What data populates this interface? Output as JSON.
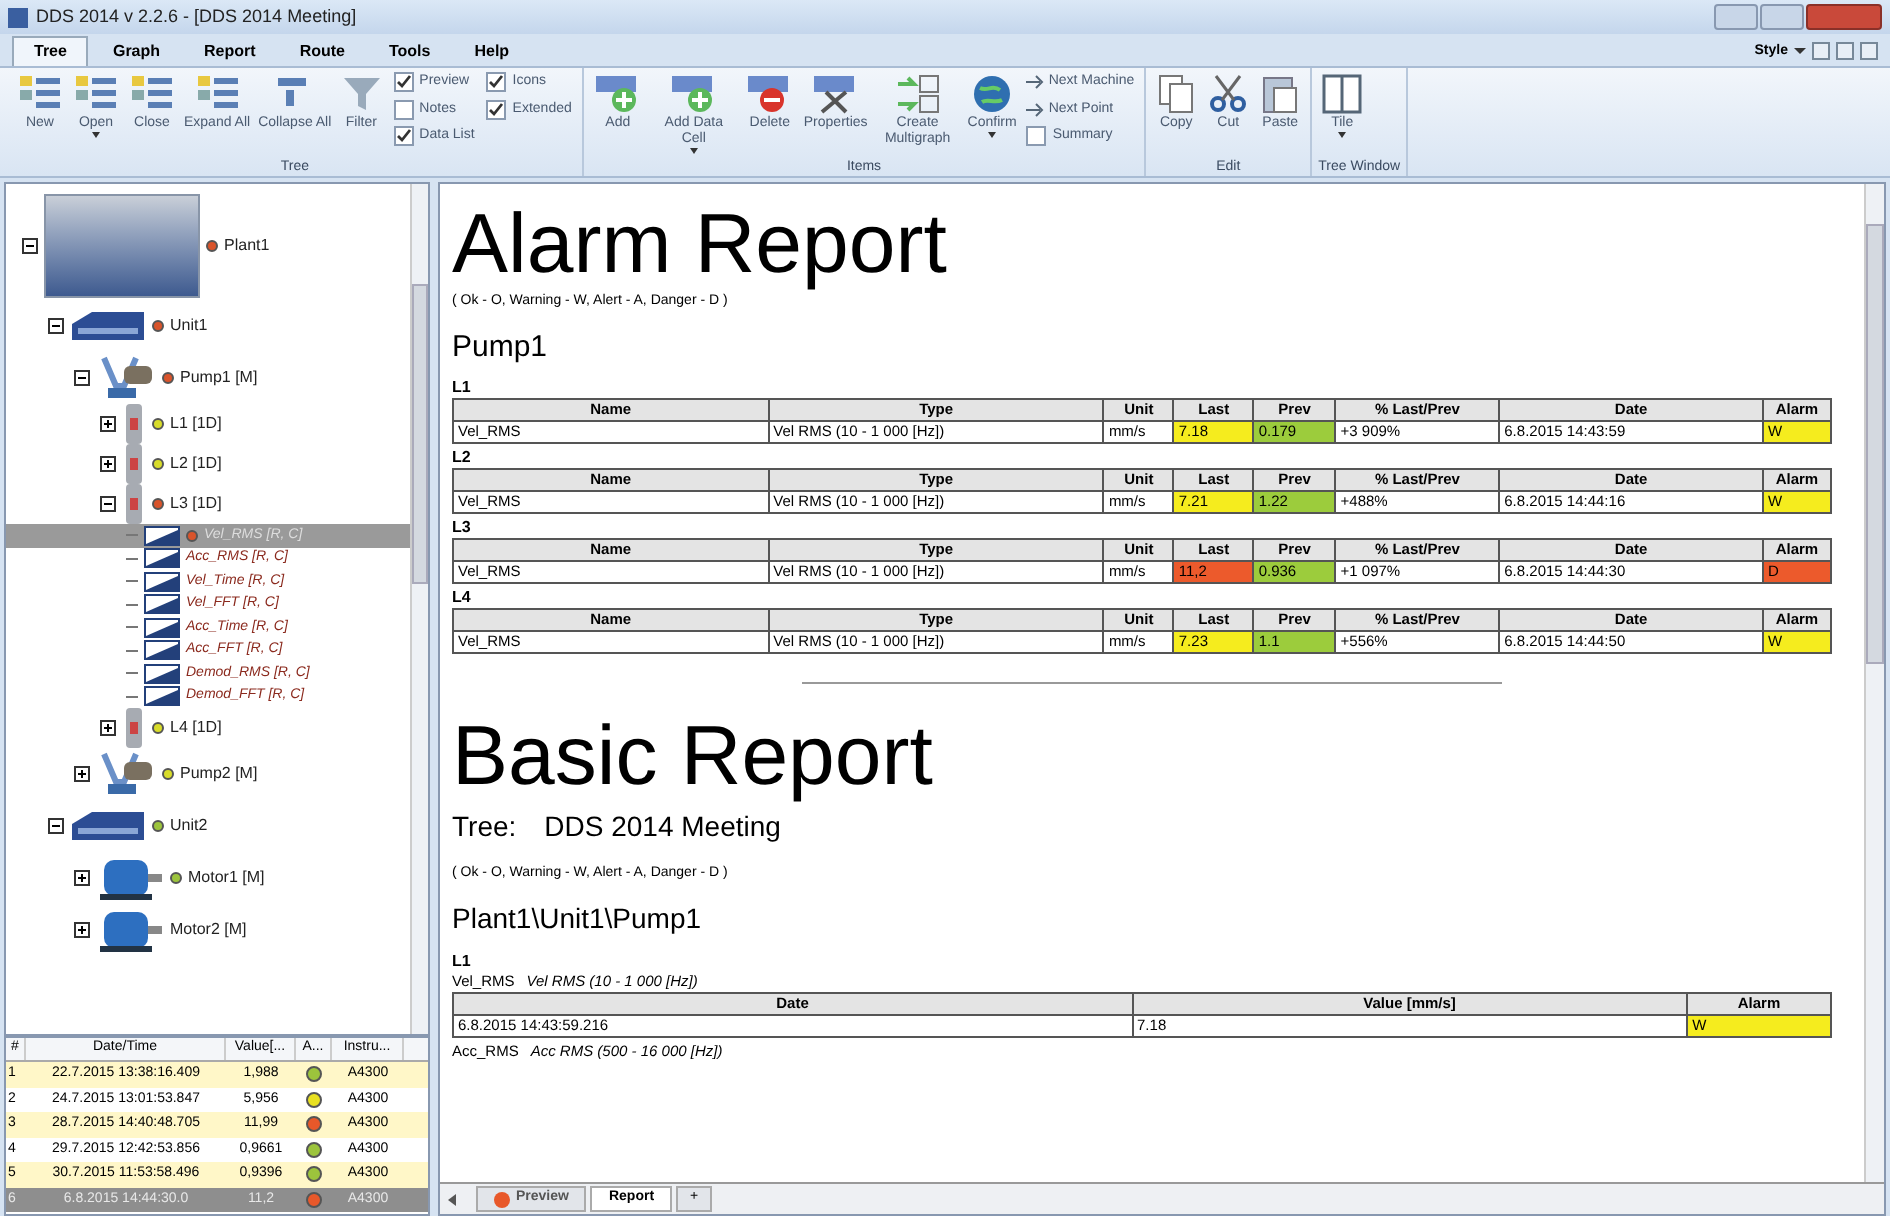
{
  "window": {
    "title": "DDS 2014 v 2.2.6 - [DDS 2014 Meeting]"
  },
  "menu_tabs": [
    {
      "label": "Tree",
      "selected": true
    },
    {
      "label": "Graph",
      "selected": false
    },
    {
      "label": "Report",
      "selected": false
    },
    {
      "label": "Route",
      "selected": false
    },
    {
      "label": "Tools",
      "selected": false
    },
    {
      "label": "Help",
      "selected": false
    }
  ],
  "style_menu": "Style",
  "ribbon": [
    {
      "name": "Tree",
      "items": [
        {
          "kind": "button",
          "label": "New"
        },
        {
          "kind": "button",
          "label": "Open",
          "dropdown": true
        },
        {
          "kind": "button",
          "label": "Close"
        },
        {
          "kind": "button",
          "label": "Expand All"
        },
        {
          "kind": "button",
          "label": "Collapse All"
        },
        {
          "kind": "button",
          "label": "Filter"
        },
        {
          "kind": "checks",
          "checks": [
            {
              "label": "Preview",
              "checked": true
            },
            {
              "label": "Notes",
              "checked": false
            },
            {
              "label": "Data List",
              "checked": true
            }
          ]
        },
        {
          "kind": "checks",
          "checks": [
            {
              "label": "Icons",
              "checked": true
            },
            {
              "label": "Extended",
              "checked": true
            }
          ]
        }
      ]
    },
    {
      "name": "Items",
      "items": [
        {
          "kind": "button",
          "label": "Add"
        },
        {
          "kind": "button",
          "label": "Add Data Cell",
          "dropdown": true
        },
        {
          "kind": "button",
          "label": "Delete"
        },
        {
          "kind": "button",
          "label": "Properties"
        },
        {
          "kind": "button",
          "label": "Create Multigraph"
        },
        {
          "kind": "button",
          "label": "Confirm",
          "dropdown": true
        },
        {
          "kind": "small",
          "items": [
            {
              "label": "Next Machine"
            },
            {
              "label": "Next Point"
            }
          ],
          "check": {
            "label": "Summary",
            "checked": false
          }
        }
      ]
    },
    {
      "name": "Edit",
      "items": [
        {
          "kind": "button",
          "label": "Copy"
        },
        {
          "kind": "button",
          "label": "Cut"
        },
        {
          "kind": "button",
          "label": "Paste"
        }
      ]
    },
    {
      "name": "Tree Window",
      "items": [
        {
          "kind": "button",
          "label": "Tile",
          "dropdown": true
        }
      ]
    }
  ],
  "tree": [
    {
      "label": "Plant1",
      "kind": "plant",
      "color": "#d9542b",
      "expanded": true,
      "selected": false,
      "children": [
        {
          "label": "Unit1",
          "kind": "building",
          "color": "#d9542b",
          "expanded": true,
          "selected": false,
          "children": [
            {
              "label": "Pump1 [M]",
              "kind": "pump",
              "color": "#d9542b",
              "expanded": true,
              "selected": false,
              "children": [
                {
                  "label": "L1 [1D]",
                  "kind": "sensor",
                  "color": "#d8dc2a",
                  "expanded": false,
                  "selected": false
                },
                {
                  "label": "L2 [1D]",
                  "kind": "sensor",
                  "color": "#d8dc2a",
                  "expanded": false,
                  "selected": false
                },
                {
                  "label": "L3 [1D]",
                  "kind": "sensor",
                  "color": "#d9542b",
                  "expanded": true,
                  "selected": false,
                  "children": [
                    {
                      "label": "Vel_RMS [R, C]",
                      "kind": "cell",
                      "color": "#d9542b",
                      "selected": true
                    },
                    {
                      "label": "Acc_RMS [R, C]",
                      "kind": "cell",
                      "selected": false
                    },
                    {
                      "label": "Vel_Time [R, C]",
                      "kind": "cell",
                      "selected": false
                    },
                    {
                      "label": "Vel_FFT [R, C]",
                      "kind": "cell",
                      "selected": false
                    },
                    {
                      "label": "Acc_Time [R, C]",
                      "kind": "cell",
                      "selected": false
                    },
                    {
                      "label": "Acc_FFT [R, C]",
                      "kind": "cell",
                      "selected": false
                    },
                    {
                      "label": "Demod_RMS [R, C]",
                      "kind": "cell",
                      "selected": false
                    },
                    {
                      "label": "Demod_FFT [R, C]",
                      "kind": "cell",
                      "selected": false
                    }
                  ]
                },
                {
                  "label": "L4 [1D]",
                  "kind": "sensor",
                  "color": "#d8dc2a",
                  "expanded": false,
                  "selected": false
                }
              ]
            },
            {
              "label": "Pump2 [M]",
              "kind": "pump",
              "color": "#d8dc2a",
              "expanded": false,
              "selected": false
            }
          ]
        },
        {
          "label": "Unit2",
          "kind": "building",
          "color": "#9cc43c",
          "expanded": true,
          "selected": false,
          "children": [
            {
              "label": "Motor1 [M]",
              "kind": "motor",
              "color": "#9cc43c",
              "expanded": false,
              "selected": false
            },
            {
              "label": "Motor2 [M]",
              "kind": "motor",
              "expanded": false,
              "selected": false
            }
          ]
        }
      ]
    }
  ],
  "data_list": {
    "columns": [
      "#",
      "Date/Time",
      "Value[...",
      "A...",
      "Instru..."
    ],
    "rows": [
      {
        "n": "1",
        "date": "22.7.2015 13:38:16.409",
        "value": "1,988",
        "color": "#9cc43c",
        "instrument": "A4300",
        "selected": false
      },
      {
        "n": "2",
        "date": "24.7.2015 13:01:53.847",
        "value": "5,956",
        "color": "#e8e020",
        "instrument": "A4300",
        "selected": false
      },
      {
        "n": "3",
        "date": "28.7.2015 14:40:48.705",
        "value": "11,99",
        "color": "#e8582a",
        "instrument": "A4300",
        "selected": false
      },
      {
        "n": "4",
        "date": "29.7.2015 12:42:53.856",
        "value": "0,9661",
        "color": "#9cc43c",
        "instrument": "A4300",
        "selected": false
      },
      {
        "n": "5",
        "date": "30.7.2015 11:53:58.496",
        "value": "0,9396",
        "color": "#9cc43c",
        "instrument": "A4300",
        "selected": false
      },
      {
        "n": "6",
        "date": "6.8.2015 14:44:30.0",
        "value": "11,2",
        "color": "#e8582a",
        "instrument": "A4300",
        "selected": true
      }
    ]
  },
  "alarm_report": {
    "title": "Alarm Report",
    "legend": "( Ok - O, Warning - W, Alert - A, Danger - D )",
    "machine": "Pump1",
    "points": [
      {
        "name": "L1",
        "columns": [
          "Name",
          "Type",
          "Unit",
          "Last",
          "Prev",
          "% Last/Prev",
          "Date",
          "Alarm"
        ],
        "row": {
          "name": "Vel_RMS",
          "type": "Vel RMS (10 - 1 000 [Hz])",
          "unit": "mm/s",
          "last": {
            "text": "7.18",
            "color": "#f5ec1e"
          },
          "prev": {
            "text": "0.179",
            "color": "#9ccc3c"
          },
          "ratio": "+3 909%",
          "date": "6.8.2015 14:43:59",
          "alarm": {
            "text": "W",
            "color": "#f5ec1e"
          }
        }
      },
      {
        "name": "L2",
        "columns": [
          "Name",
          "Type",
          "Unit",
          "Last",
          "Prev",
          "% Last/Prev",
          "Date",
          "Alarm"
        ],
        "row": {
          "name": "Vel_RMS",
          "type": "Vel RMS (10 - 1 000 [Hz])",
          "unit": "mm/s",
          "last": {
            "text": "7.21",
            "color": "#f5ec1e"
          },
          "prev": {
            "text": "1.22",
            "color": "#9ccc3c"
          },
          "ratio": "+488%",
          "date": "6.8.2015 14:44:16",
          "alarm": {
            "text": "W",
            "color": "#f5ec1e"
          }
        }
      },
      {
        "name": "L3",
        "columns": [
          "Name",
          "Type",
          "Unit",
          "Last",
          "Prev",
          "% Last/Prev",
          "Date",
          "Alarm"
        ],
        "row": {
          "name": "Vel_RMS",
          "type": "Vel RMS (10 - 1 000 [Hz])",
          "unit": "mm/s",
          "last": {
            "text": "11,2",
            "color": "#ec5a2c"
          },
          "prev": {
            "text": "0.936",
            "color": "#9ccc3c"
          },
          "ratio": "+1 097%",
          "date": "6.8.2015 14:44:30",
          "alarm": {
            "text": "D",
            "color": "#ec5a2c"
          }
        }
      },
      {
        "name": "L4",
        "columns": [
          "Name",
          "Type",
          "Unit",
          "Last",
          "Prev",
          "% Last/Prev",
          "Date",
          "Alarm"
        ],
        "row": {
          "name": "Vel_RMS",
          "type": "Vel RMS (10 - 1 000 [Hz])",
          "unit": "mm/s",
          "last": {
            "text": "7.23",
            "color": "#f5ec1e"
          },
          "prev": {
            "text": "1.1",
            "color": "#9ccc3c"
          },
          "ratio": "+556%",
          "date": "6.8.2015 14:44:50",
          "alarm": {
            "text": "W",
            "color": "#f5ec1e"
          }
        }
      }
    ]
  },
  "basic_report": {
    "title": "Basic Report",
    "tree_label": "Tree:",
    "tree_name": "DDS 2014 Meeting",
    "legend": "( Ok - O, Warning - W, Alert - A, Danger - D )",
    "path": "Plant1\\Unit1\\Pump1",
    "point": "L1",
    "cells": [
      {
        "name": "Vel_RMS",
        "type": "Vel RMS (10 - 1 000 [Hz])",
        "columns": [
          "Date",
          "Value [mm/s]",
          "Alarm"
        ],
        "rows": [
          {
            "date": "6.8.2015 14:43:59.216",
            "value": "7.18",
            "alarm": {
              "text": "W",
              "color": "#f5ec1e"
            }
          }
        ]
      },
      {
        "name": "Acc_RMS",
        "type": "Acc RMS (500 - 16 000 [Hz])"
      }
    ]
  },
  "bottom_tabs": [
    {
      "label": "Preview",
      "color": "#e8582a",
      "selected": false
    },
    {
      "label": "Report",
      "selected": true
    }
  ],
  "add_tab": "+"
}
